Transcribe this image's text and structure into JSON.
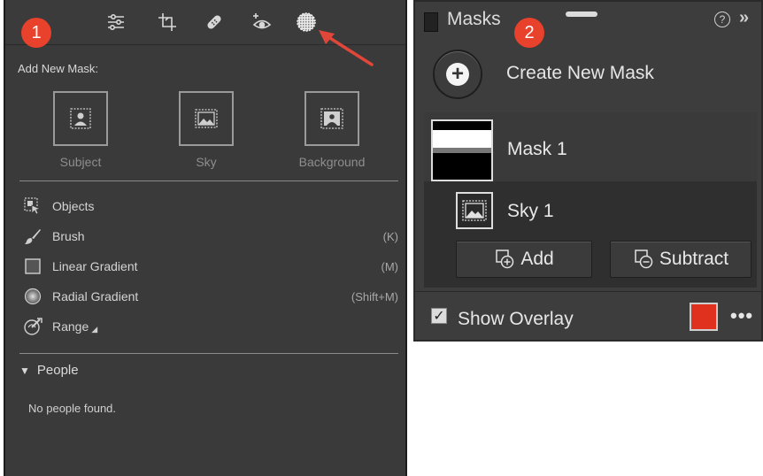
{
  "left_panel": {
    "badge": "1",
    "toolbar_icons": [
      "sliders-icon",
      "crop-icon",
      "heal-icon",
      "redeye-icon",
      "masking-icon"
    ],
    "add_new_mask_label": "Add New Mask:",
    "mask_types": [
      {
        "label": "Subject",
        "icon": "subject-icon"
      },
      {
        "label": "Sky",
        "icon": "sky-icon"
      },
      {
        "label": "Background",
        "icon": "background-icon"
      }
    ],
    "tools": [
      {
        "label": "Objects",
        "shortcut": "",
        "icon": "objects-icon"
      },
      {
        "label": "Brush",
        "shortcut": "(K)",
        "icon": "brush-icon"
      },
      {
        "label": "Linear Gradient",
        "shortcut": "(M)",
        "icon": "linear-gradient-icon"
      },
      {
        "label": "Radial Gradient",
        "shortcut": "(Shift+M)",
        "icon": "radial-gradient-icon"
      },
      {
        "label": "Range",
        "shortcut": "",
        "icon": "range-icon"
      }
    ],
    "people_header": "People",
    "people_empty": "No people found."
  },
  "right_panel": {
    "badge": "2",
    "title": "Masks",
    "create_label": "Create New Mask",
    "mask_name": "Mask 1",
    "component_name": "Sky 1",
    "add_label": "Add",
    "subtract_label": "Subtract",
    "show_overlay_label": "Show Overlay",
    "overlay_color": "#e0301e"
  },
  "colors": {
    "badge": "#e8412c",
    "arrow": "#e0473a"
  }
}
